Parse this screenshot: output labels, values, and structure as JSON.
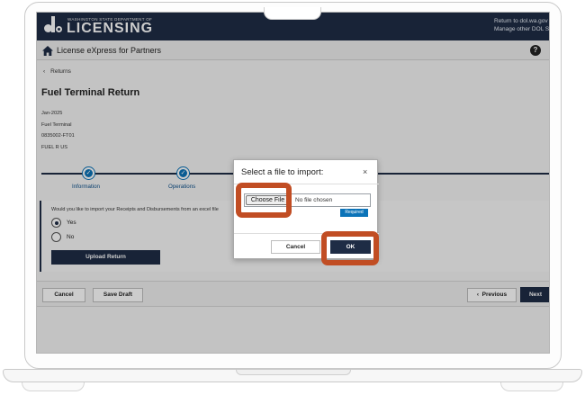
{
  "header": {
    "agency_small": "WASHINGTON STATE DEPARTMENT OF",
    "agency_big": "LICENSING",
    "link_return": "Return to dol.wa.gov",
    "link_manage": "Manage other DOL S"
  },
  "subnav": {
    "title": "License eXpress for Partners",
    "help_glyph": "?"
  },
  "breadcrumb": {
    "back_label": "Returns"
  },
  "page": {
    "title": "Fuel Terminal Return",
    "meta": [
      "Jan-2025",
      "Fuel Terminal",
      "0835002-FT01",
      "FUEL R US"
    ]
  },
  "stepper": {
    "steps": [
      {
        "label": "Information",
        "state": "complete"
      },
      {
        "label": "Operations",
        "state": "complete"
      }
    ]
  },
  "import_panel": {
    "question": "Would you like to import your Receipts and Disbursements from an excel file",
    "options": [
      {
        "label": "Yes",
        "selected": true
      },
      {
        "label": "No",
        "selected": false
      }
    ],
    "upload_label": "Upload Return"
  },
  "footer": {
    "cancel_label": "Cancel",
    "save_draft_label": "Save Draft",
    "previous_label": "Previous",
    "next_label": "Next"
  },
  "modal": {
    "title": "Select a file to import:",
    "close_glyph": "×",
    "choose_file_label": "Choose File",
    "file_status": "No file chosen",
    "required_label": "Required",
    "cancel_label": "Cancel",
    "ok_label": "OK"
  },
  "colors": {
    "header_navy": "#1e2c45",
    "step_blue": "#0b73b8",
    "highlight_orange": "#c14d23"
  },
  "icons": [
    "home-icon",
    "help-icon",
    "chevron-left-icon",
    "check-icon",
    "close-icon"
  ]
}
